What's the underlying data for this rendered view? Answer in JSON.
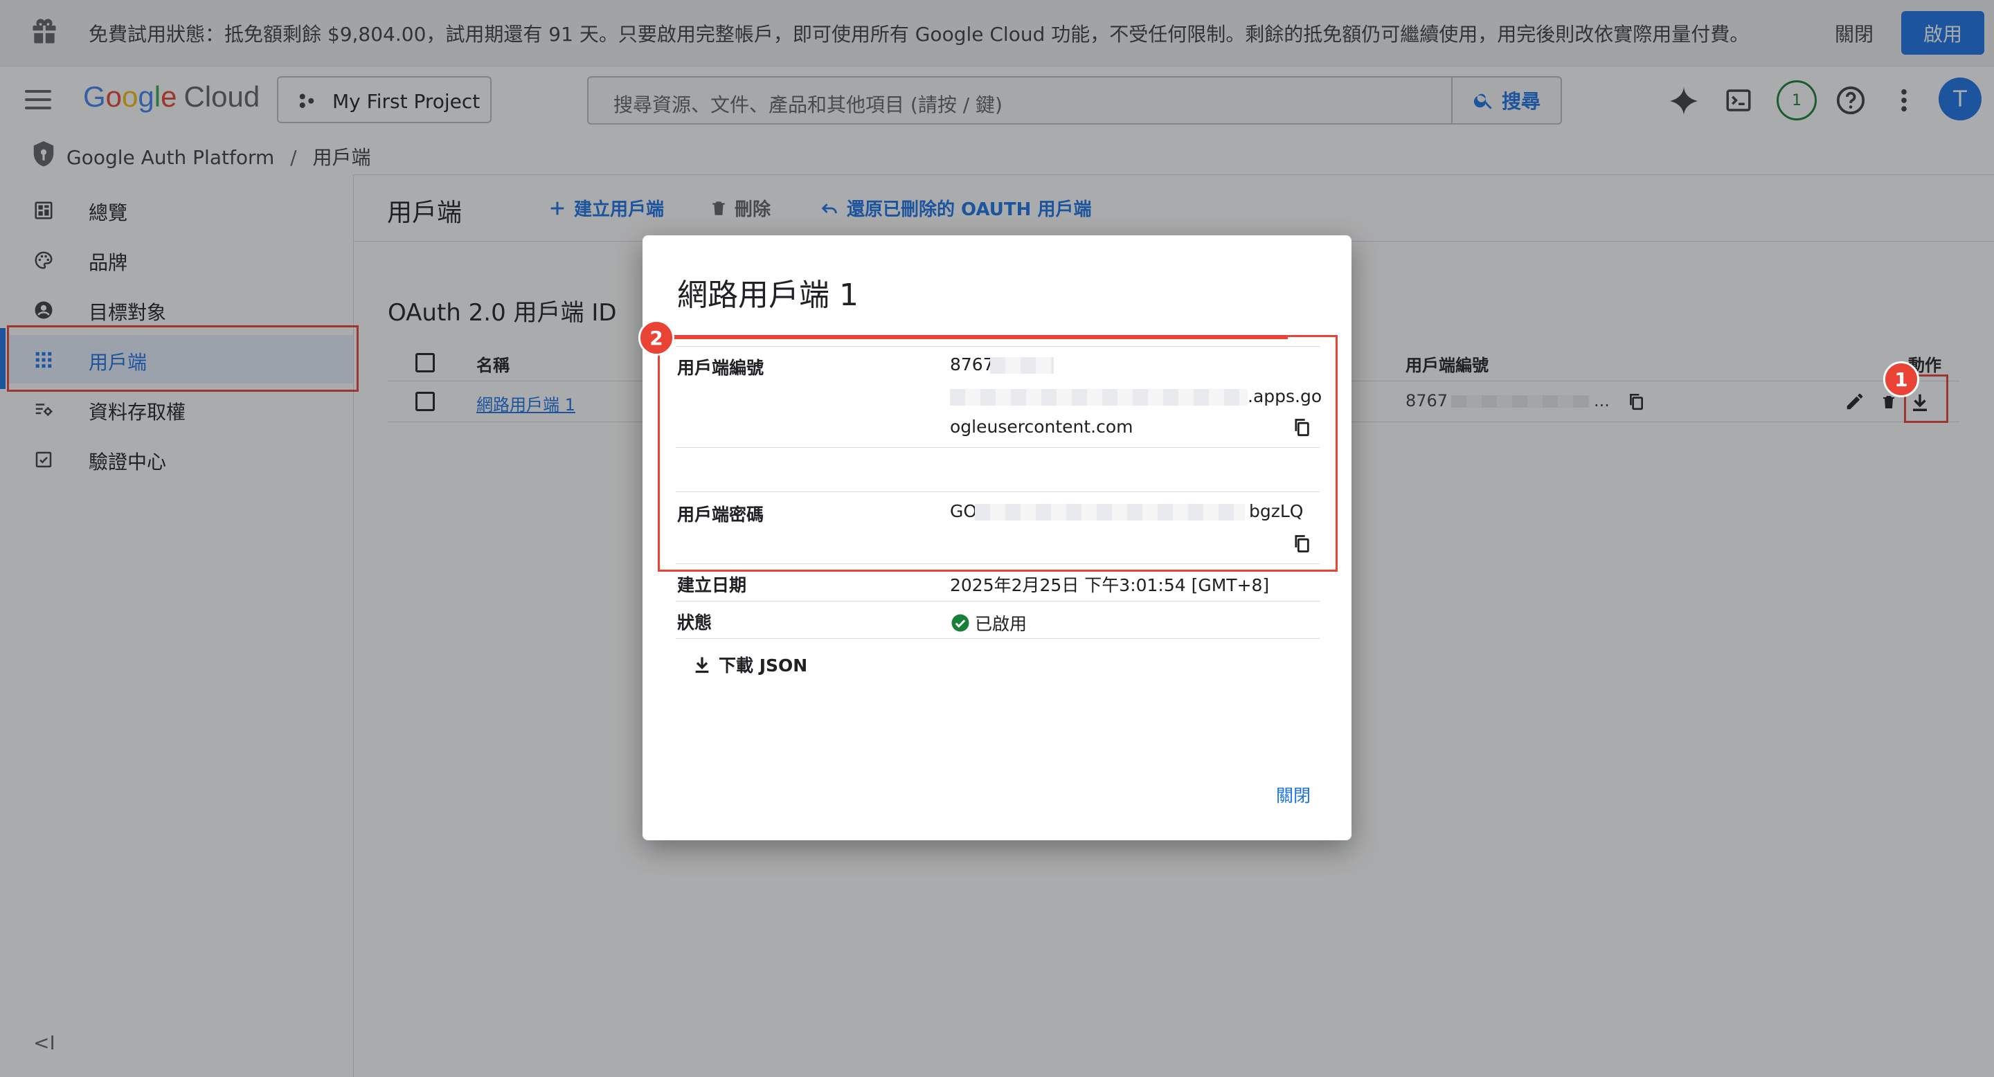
{
  "banner": {
    "text": "免費試用狀態：抵免額剩餘 $9,804.00，試用期還有 91 天。只要啟用完整帳戶，即可使用所有 Google Cloud 功能，不受任何限制。剩餘的抵免額仍可繼續使用，用完後則改依實際用量付費。",
    "dismiss_label": "關閉",
    "activate_label": "啟用"
  },
  "header": {
    "logo_letters": [
      "G",
      "o",
      "o",
      "g",
      "l",
      "e"
    ],
    "logo_product": "Cloud",
    "project_name": "My First Project",
    "search_placeholder": "搜尋資源、文件、產品和其他項目 (請按 / 鍵)",
    "search_button": "搜尋",
    "notification_count": "1",
    "avatar_letter": "T"
  },
  "breadcrumb": {
    "product": "Google Auth Platform",
    "separator": "/",
    "page": "用戶端"
  },
  "sidebar": {
    "items": [
      {
        "label": "總覽",
        "icon": "dashboard-icon"
      },
      {
        "label": "品牌",
        "icon": "palette-icon"
      },
      {
        "label": "目標對象",
        "icon": "account-circle-icon"
      },
      {
        "label": "用戶端",
        "icon": "apps-grid-icon",
        "active": true
      },
      {
        "label": "資料存取權",
        "icon": "data-access-icon"
      },
      {
        "label": "驗證中心",
        "icon": "verified-checkbox-icon"
      }
    ],
    "collapse_label": "<I"
  },
  "toolbar": {
    "title": "用戶端",
    "create_label": "建立用戶端",
    "delete_label": "刪除",
    "restore_label": "還原已刪除的 OAUTH 用戶端"
  },
  "main": {
    "section_title": "OAuth 2.0 用戶端 ID",
    "columns": {
      "name": "名稱",
      "client_id": "用戶端編號",
      "actions": "動作"
    },
    "row": {
      "name": "網路用戶端 1",
      "client_id_prefix": "8767",
      "client_id_ellipsis": "..."
    }
  },
  "dialog": {
    "title": "網路用戶端 1",
    "client_id_label": "用戶端編號",
    "client_id_line1": "8767",
    "client_id_line2_suffix": ".apps.go",
    "client_id_line3": "ogleusercontent.com",
    "client_secret_label": "用戶端密碼",
    "client_secret_prefix": "GO",
    "client_secret_suffix": "bgzLQ",
    "created_label": "建立日期",
    "created_value": "2025年2月25日 下午3:01:54 [GMT+8]",
    "status_label": "狀態",
    "status_value": "已啟用",
    "download_label": "下載 JSON",
    "close_label": "關閉"
  },
  "callouts": {
    "one": "1",
    "two": "2"
  },
  "colors": {
    "accent": "#1a73e8",
    "highlight_red": "#ea4335",
    "success_green": "#188038"
  }
}
